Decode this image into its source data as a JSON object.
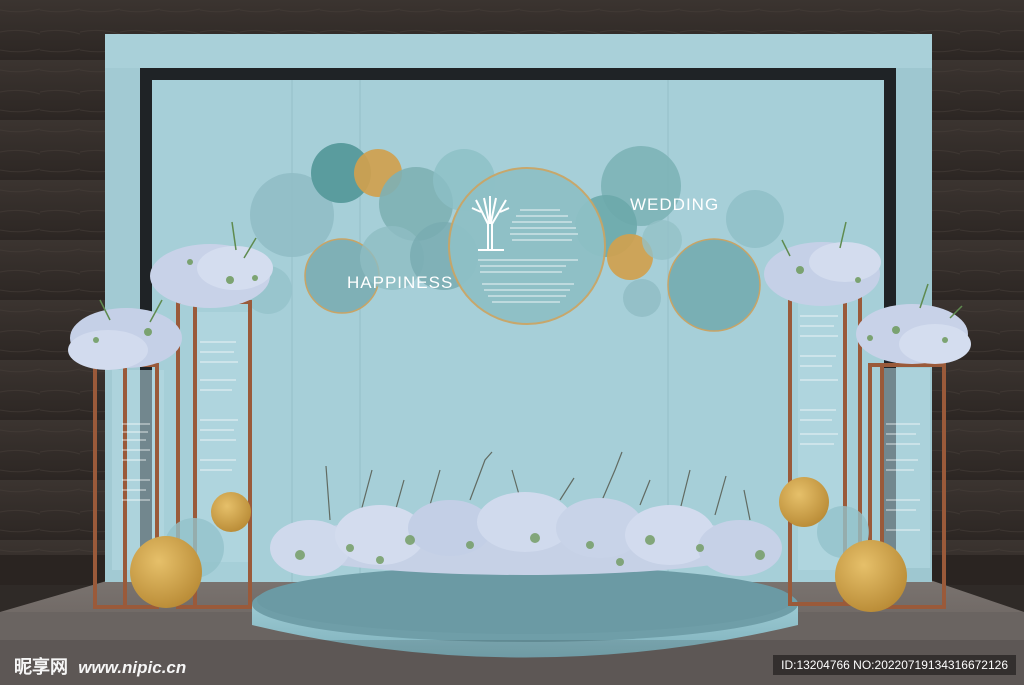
{
  "backdrop": {
    "word_left": "HAPPINESS",
    "word_right": "WEDDING"
  },
  "watermark": {
    "site_cn": "昵享网",
    "site_url": "www.nipic.cn",
    "id_text": "ID:13204766 NO:20220719134316672126"
  },
  "colors": {
    "wall": "#3a332f",
    "floor": "#6e6864",
    "backdrop_blue": "#a9d0d9",
    "teal_circle": "#5fa3a6",
    "gold": "#d2a74f",
    "copper_frame": "#9a5a3a",
    "stage": "#8cbac4",
    "flowers": "#c7d3ea"
  },
  "icons": [
    "tree-icon"
  ]
}
